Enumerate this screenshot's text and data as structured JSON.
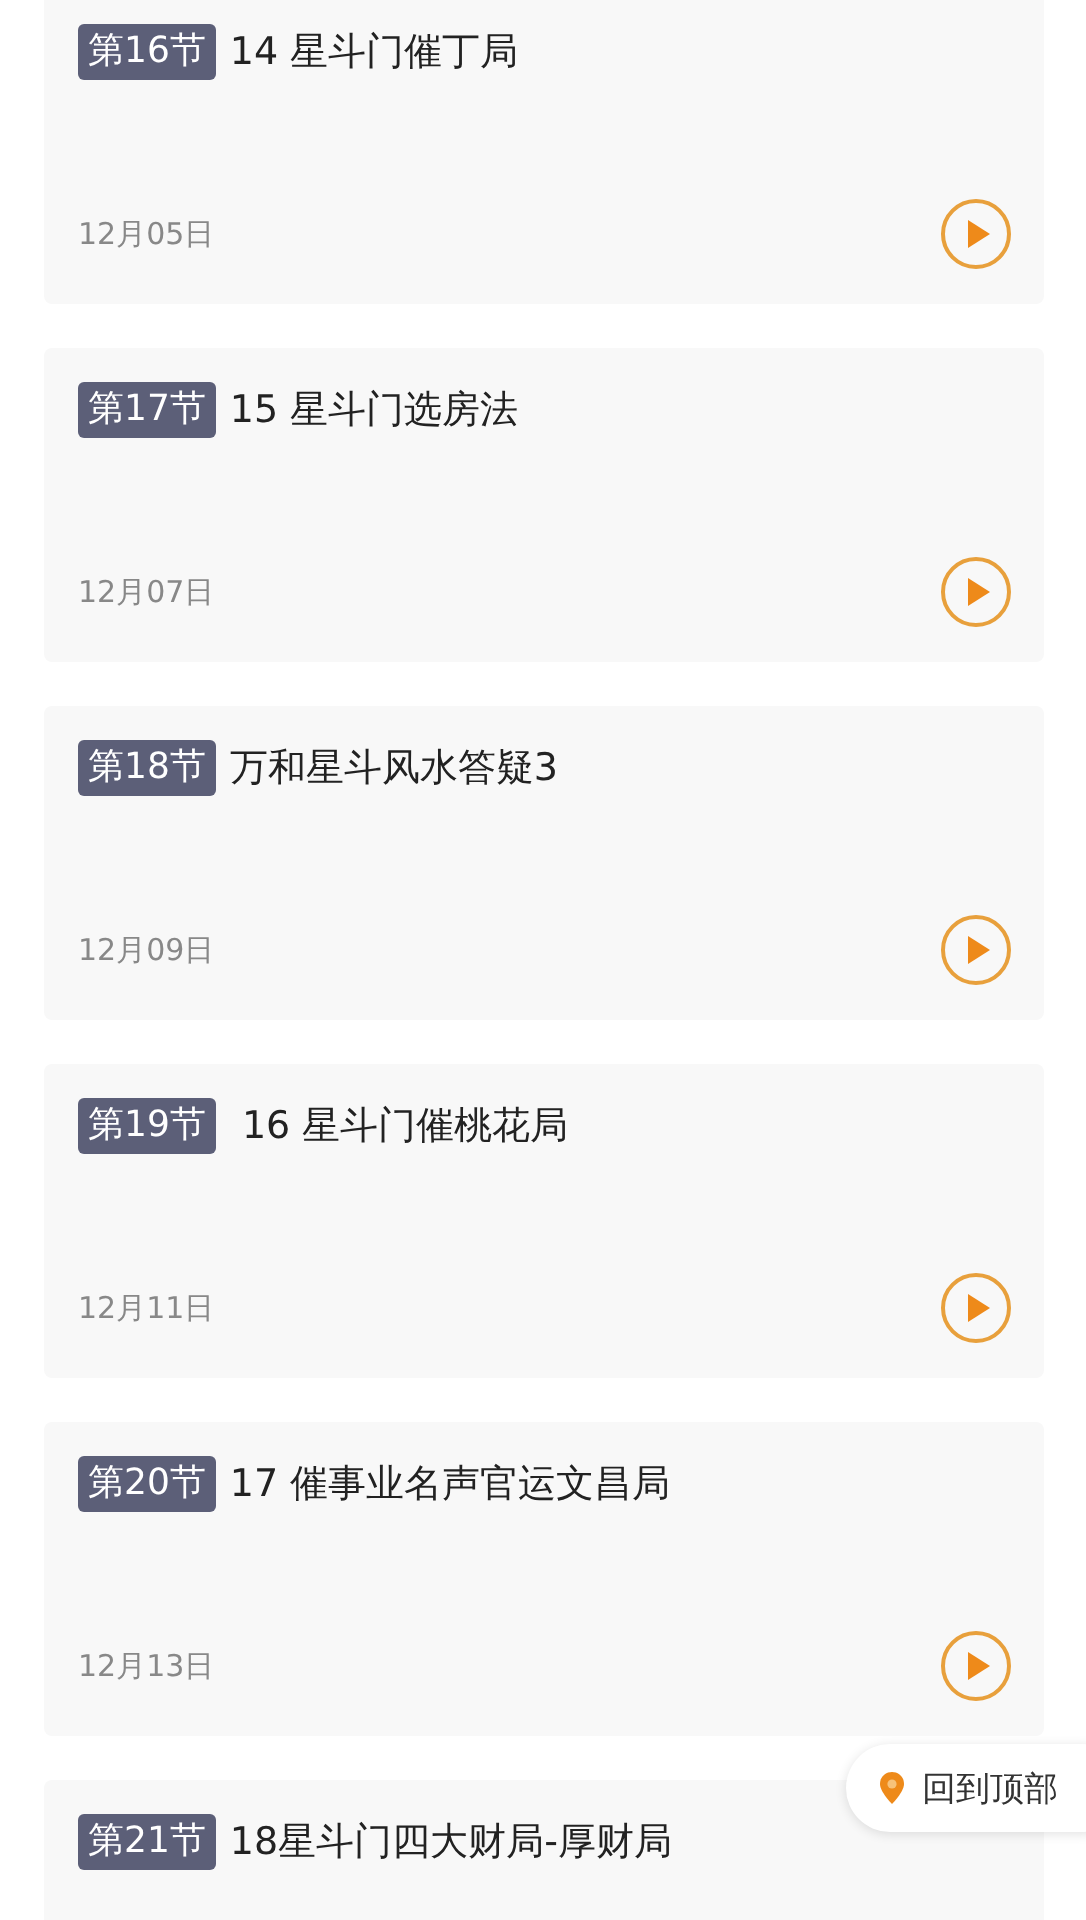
{
  "lessons": [
    {
      "tag": "第16节",
      "title": "14 星斗门催丁局",
      "date": "12月05日"
    },
    {
      "tag": "第17节",
      "title": "15 星斗门选房法",
      "date": "12月07日"
    },
    {
      "tag": "第18节",
      "title": "万和星斗风水答疑3",
      "date": "12月09日"
    },
    {
      "tag": "第19节",
      "title": " 16 星斗门催桃花局",
      "date": "12月11日"
    },
    {
      "tag": "第20节",
      "title": "17 催事业名声官运文昌局",
      "date": "12月13日"
    },
    {
      "tag": "第21节",
      "title": "18星斗门四大财局-厚财局"
    }
  ],
  "back_to_top": {
    "label": "回到顶部"
  }
}
